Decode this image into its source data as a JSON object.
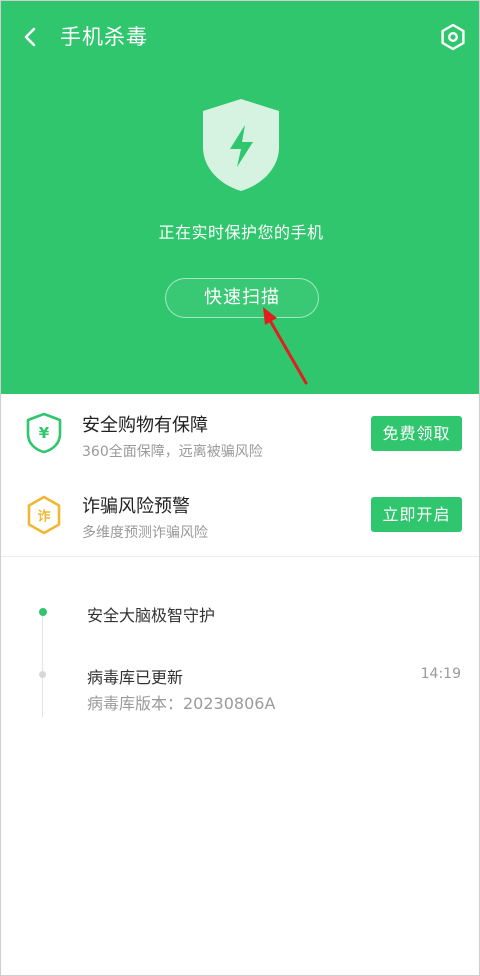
{
  "header": {
    "title": "手机杀毒",
    "back_icon": "chevron-left-icon",
    "settings_icon": "hexagon-gear-icon"
  },
  "hero": {
    "status_text": "正在实时保护您的手机",
    "scan_button_label": "快速扫描",
    "background_color": "#2fc66d",
    "shield_icon": "shield-lightning-icon"
  },
  "cards": [
    {
      "title": "安全购物有保障",
      "subtitle": "360全面保障，远离被骗风险",
      "button_label": "免费领取",
      "icon": "shield-yen-icon"
    },
    {
      "title": "诈骗风险预警",
      "subtitle": "多维度预测诈骗风险",
      "button_label": "立即开启",
      "icon": "hexagon-fraud-icon"
    }
  ],
  "timeline": [
    {
      "title": "安全大脑极智守护"
    },
    {
      "title": "病毒库已更新",
      "subtitle": "病毒库版本：20230806A",
      "time": "14:19"
    }
  ],
  "colors": {
    "accent": "#2fc66d",
    "annotation_arrow": "#e02020",
    "fraud_icon": "#f2b632"
  }
}
